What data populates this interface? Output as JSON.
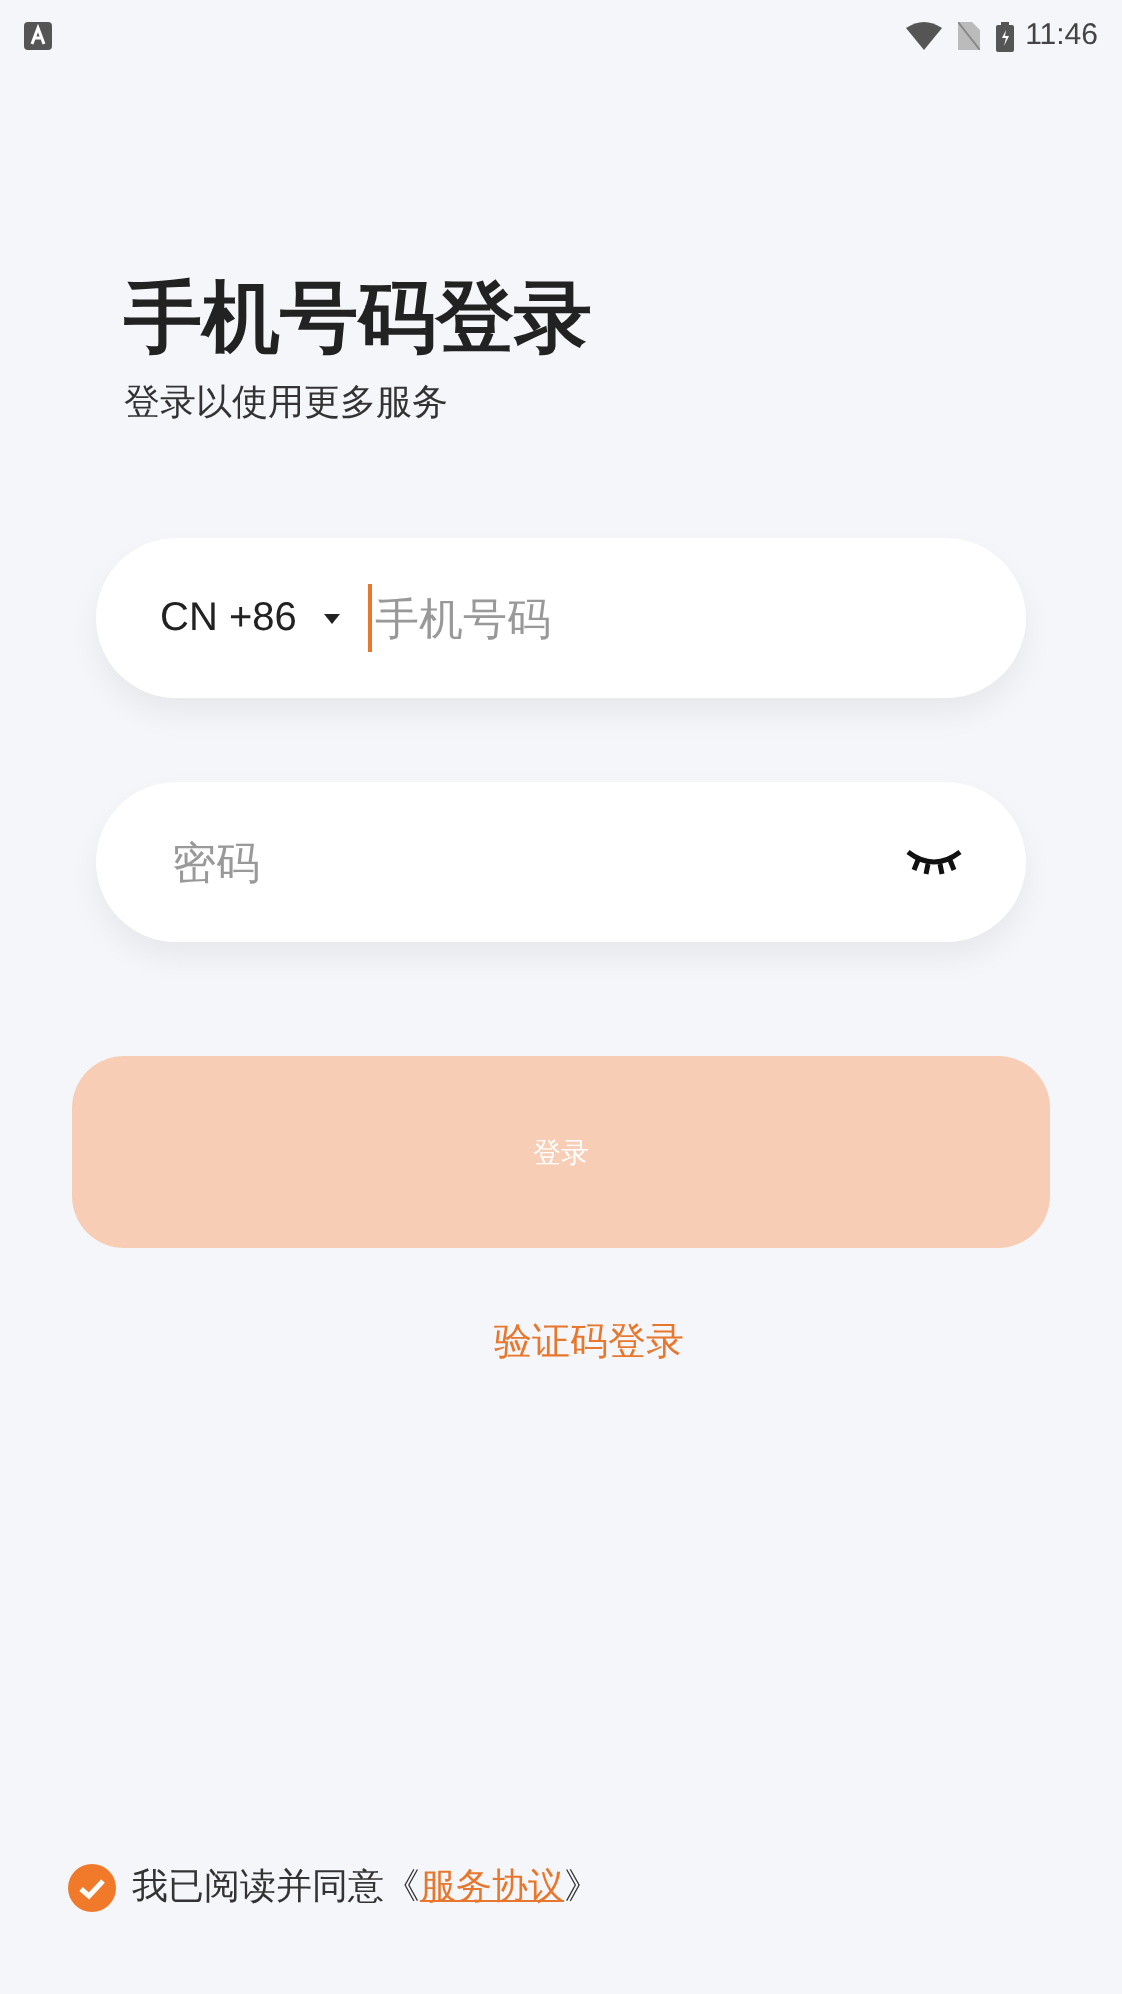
{
  "status_bar": {
    "time": "11:46"
  },
  "title": "手机号码登录",
  "subtitle": "登录以使用更多服务",
  "phone_field": {
    "country_code": "CN +86",
    "placeholder": "手机号码",
    "focused": true
  },
  "password_field": {
    "placeholder": "密码",
    "visible": false
  },
  "login_button": {
    "label": "登录",
    "disabled": true
  },
  "alt_login": "验证码登录",
  "agreement": {
    "checked": true,
    "text_before": "我已阅读并同意《",
    "link": "服务协议",
    "text_after": "》"
  }
}
